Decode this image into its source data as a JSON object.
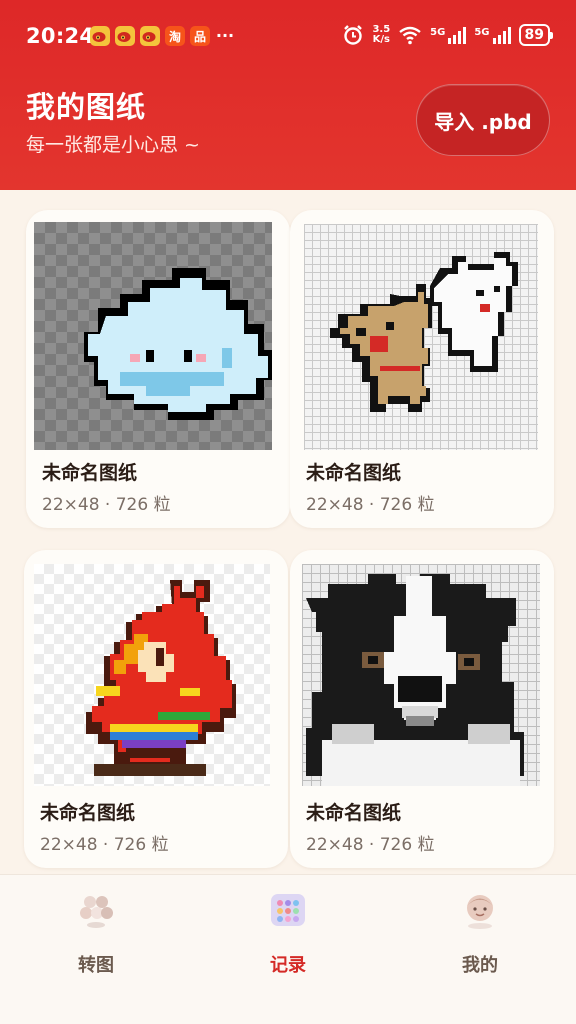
{
  "status_bar": {
    "time": "20:24",
    "app_icons": [
      "weibo-icon",
      "weibo-icon",
      "weibo-icon",
      "taobao-icon",
      "app-icon"
    ],
    "taobao_char": "淘",
    "other_char": "品",
    "more": "···",
    "net_speed_value": "3.5",
    "net_speed_unit": "K/s",
    "signal1_label": "5G",
    "signal2_label": "5G",
    "battery": "89"
  },
  "header": {
    "title": "我的图纸",
    "subtitle": "每一张都是小心思 ~",
    "import_label": "导入 .pbd",
    "color": "#de2828"
  },
  "cards": [
    {
      "name": "未命名图纸",
      "meta": "22×48 · 726 粒"
    },
    {
      "name": "未命名图纸",
      "meta": "22×48 · 726 粒"
    },
    {
      "name": "未命名图纸",
      "meta": "22×48 · 726 粒"
    },
    {
      "name": "未命名图纸",
      "meta": "22×48 · 726 粒"
    }
  ],
  "nav": {
    "items": [
      {
        "label": "转图",
        "icon": "beads-icon",
        "active": false
      },
      {
        "label": "记录",
        "icon": "palette-icon",
        "active": true
      },
      {
        "label": "我的",
        "icon": "profile-icon",
        "active": false
      }
    ],
    "active_color": "#d42a26"
  }
}
